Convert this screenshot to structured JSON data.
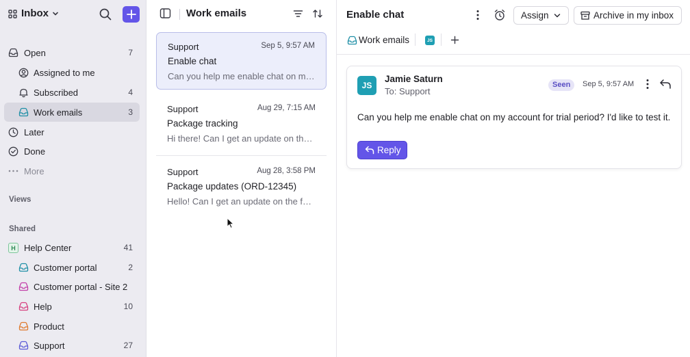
{
  "sidebar": {
    "title": "Inbox",
    "items": [
      {
        "label": "Open",
        "count": "7"
      },
      {
        "label": "Assigned to me",
        "count": ""
      },
      {
        "label": "Subscribed",
        "count": "4"
      },
      {
        "label": "Work emails",
        "count": "3"
      },
      {
        "label": "Later",
        "count": ""
      },
      {
        "label": "Done",
        "count": ""
      },
      {
        "label": "More",
        "count": ""
      }
    ],
    "views_heading": "Views",
    "shared_heading": "Shared",
    "shared": [
      {
        "label": "Help Center",
        "count": "41",
        "badge": "H"
      },
      {
        "label": "Customer portal",
        "count": "2"
      },
      {
        "label": "Customer portal - Site 2",
        "count": ""
      },
      {
        "label": "Help",
        "count": "10"
      },
      {
        "label": "Product",
        "count": ""
      },
      {
        "label": "Support",
        "count": "27"
      }
    ]
  },
  "list": {
    "title": "Work emails",
    "conversations": [
      {
        "from": "Support",
        "time": "Sep 5, 9:57 AM",
        "subject": "Enable chat",
        "preview": "Can you help me enable chat on my account for trial period?"
      },
      {
        "from": "Support",
        "time": "Aug 29, 7:15 AM",
        "subject": "Package tracking",
        "preview": "Hi there! Can I get an update on the tracking of my package?"
      },
      {
        "from": "Support",
        "time": "Aug 28, 3:58 PM",
        "subject": "Package updates (ORD-12345)",
        "preview": "Hello! Can I get an update on the fulfillment of my order?"
      }
    ]
  },
  "detail": {
    "title": "Enable chat",
    "assign_label": "Assign",
    "archive_label": "Archive in my inbox",
    "tag_inbox": "Work emails",
    "tag_avatar": "JS",
    "message": {
      "avatar": "JS",
      "sender": "Jamie Saturn",
      "to": "To: Support",
      "seen": "Seen",
      "date": "Sep 5, 9:57 AM",
      "body": "Can you help me enable chat on my account for trial period? I'd like to test it.",
      "reply_label": "Reply"
    }
  },
  "colors": {
    "accent": "#6355e8",
    "avatar": "#1f9fb3",
    "sidebar_bg": "#ecebf1"
  },
  "icons": [
    "grid-icon",
    "search-icon",
    "plus-icon",
    "inbox-icon",
    "user-circle-icon",
    "bell-icon",
    "clock-icon",
    "check-circle-icon",
    "more-dots-icon",
    "panel-icon",
    "filter-icon",
    "sort-icon",
    "kebab-icon",
    "alarm-icon",
    "archive-icon",
    "reply-icon",
    "cursor-icon"
  ]
}
